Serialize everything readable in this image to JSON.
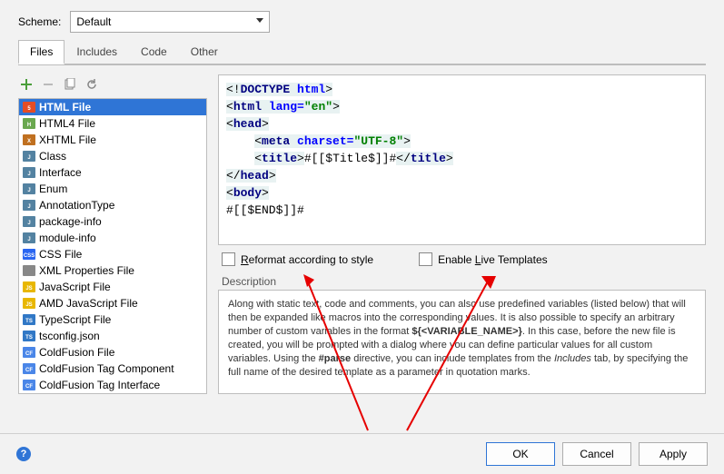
{
  "scheme": {
    "label": "Scheme:",
    "value": "Default"
  },
  "tabs": [
    "Files",
    "Includes",
    "Code",
    "Other"
  ],
  "activeTab": 0,
  "fileList": [
    {
      "label": "HTML File",
      "icon": "html5",
      "selected": true
    },
    {
      "label": "HTML4 File",
      "icon": "html"
    },
    {
      "label": "XHTML File",
      "icon": "xhtml"
    },
    {
      "label": "Class",
      "icon": "java"
    },
    {
      "label": "Interface",
      "icon": "java"
    },
    {
      "label": "Enum",
      "icon": "java"
    },
    {
      "label": "AnnotationType",
      "icon": "java"
    },
    {
      "label": "package-info",
      "icon": "java"
    },
    {
      "label": "module-info",
      "icon": "java"
    },
    {
      "label": "CSS File",
      "icon": "css"
    },
    {
      "label": "XML Properties File",
      "icon": "xml"
    },
    {
      "label": "JavaScript File",
      "icon": "js"
    },
    {
      "label": "AMD JavaScript File",
      "icon": "js"
    },
    {
      "label": "TypeScript File",
      "icon": "ts"
    },
    {
      "label": "tsconfig.json",
      "icon": "ts"
    },
    {
      "label": "ColdFusion File",
      "icon": "cf"
    },
    {
      "label": "ColdFusion Tag Component",
      "icon": "cf"
    },
    {
      "label": "ColdFusion Tag Interface",
      "icon": "cf"
    }
  ],
  "code": [
    {
      "segs": [
        {
          "t": "<!",
          "c": "plain hl"
        },
        {
          "t": "DOCTYPE ",
          "c": "kw hl"
        },
        {
          "t": "html",
          "c": "attr hl"
        },
        {
          "t": ">",
          "c": "plain hl"
        }
      ]
    },
    {
      "segs": [
        {
          "t": "<",
          "c": "plain hl"
        },
        {
          "t": "html ",
          "c": "kw hl"
        },
        {
          "t": "lang=",
          "c": "attr hl"
        },
        {
          "t": "\"en\"",
          "c": "val hl"
        },
        {
          "t": ">",
          "c": "plain hl"
        }
      ]
    },
    {
      "segs": [
        {
          "t": "<",
          "c": "plain hl"
        },
        {
          "t": "head",
          "c": "kw hl"
        },
        {
          "t": ">",
          "c": "plain hl"
        }
      ]
    },
    {
      "segs": [
        {
          "t": "    ",
          "c": "plain"
        },
        {
          "t": "<",
          "c": "plain hl"
        },
        {
          "t": "meta ",
          "c": "kw hl"
        },
        {
          "t": "charset=",
          "c": "attr hl"
        },
        {
          "t": "\"UTF-8\"",
          "c": "val hl"
        },
        {
          "t": ">",
          "c": "plain hl"
        }
      ]
    },
    {
      "segs": [
        {
          "t": "    ",
          "c": "plain"
        },
        {
          "t": "<",
          "c": "plain hl"
        },
        {
          "t": "title",
          "c": "kw hl"
        },
        {
          "t": ">",
          "c": "plain hl"
        },
        {
          "t": "#[[$Title$]]#",
          "c": "plain"
        },
        {
          "t": "</",
          "c": "plain hl"
        },
        {
          "t": "title",
          "c": "kw hl"
        },
        {
          "t": ">",
          "c": "plain hl"
        }
      ]
    },
    {
      "segs": [
        {
          "t": "</",
          "c": "plain hl"
        },
        {
          "t": "head",
          "c": "kw hl"
        },
        {
          "t": ">",
          "c": "plain hl"
        }
      ]
    },
    {
      "segs": [
        {
          "t": "<",
          "c": "plain hl"
        },
        {
          "t": "body",
          "c": "kw hl"
        },
        {
          "t": ">",
          "c": "plain hl"
        }
      ]
    },
    {
      "segs": [
        {
          "t": "#[[$END$]]#",
          "c": "plain"
        }
      ]
    }
  ],
  "checkboxes": {
    "reformat": "Reformat according to style",
    "liveTemplates": "Enable Live Templates"
  },
  "descriptionLabel": "Description",
  "description": "Along with static text, code and comments, you can also use predefined variables (listed below) that will then be expanded like macros into the corresponding values. It is also possible to specify an arbitrary number of custom variables in the format ${<VARIABLE_NAME>}. In this case, before the new file is created, you will be prompted with a dialog where you can define particular values for all custom variables. Using the #parse directive, you can include templates from the Includes tab, by specifying the full name of the desired template as a parameter in quotation marks.",
  "buttons": {
    "ok": "OK",
    "cancel": "Cancel",
    "apply": "Apply"
  }
}
